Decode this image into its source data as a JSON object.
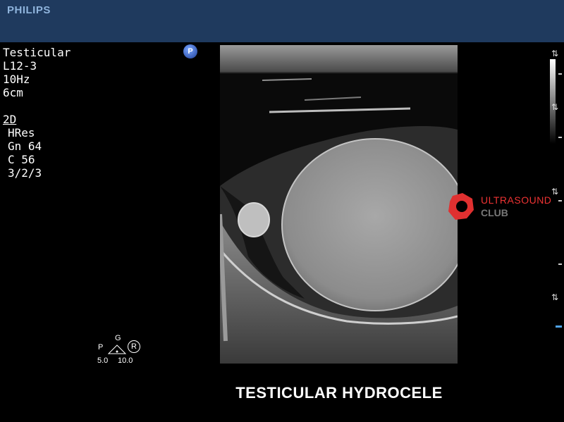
{
  "header": {
    "brand": "PHILIPS"
  },
  "params": {
    "preset": "Testicular",
    "transducer": "L12-3",
    "frame_rate": "10Hz",
    "depth": "6cm",
    "mode": "2D",
    "resolution": "HRes",
    "gain": "Gn 64",
    "compression": "C 56",
    "persistence": "3/2/3"
  },
  "badge": {
    "label": "P"
  },
  "logo": {
    "line1": "ULTRASOUND",
    "line2": "CLUB",
    "color": "#e03030"
  },
  "probe_indicator": {
    "p": "P",
    "g": "G",
    "r": "R",
    "left_value": "5.0",
    "right_value": "10.0"
  },
  "caption": "TESTICULAR  HYDROCELE"
}
